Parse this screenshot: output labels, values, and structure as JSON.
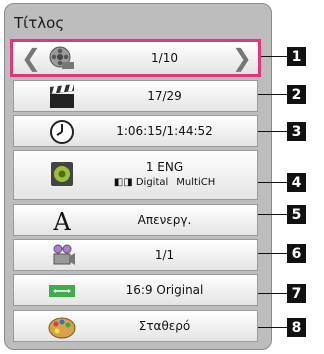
{
  "panel": {
    "title": "Τίτλος"
  },
  "rows": [
    {
      "icon": "film-reel-camera-icon",
      "value": "1/10",
      "callout": "1"
    },
    {
      "icon": "clapperboard-icon",
      "value": "17/29",
      "callout": "2"
    },
    {
      "icon": "clock-icon",
      "value": "1:06:15/1:44:52",
      "callout": "3"
    },
    {
      "icon": "speaker-icon",
      "value": "1 ENG",
      "sub_a": "Digital",
      "sub_b": "MultiCH",
      "callout": "4"
    },
    {
      "icon": "subtitle-letter-icon",
      "value": "Απενεργ.",
      "callout": "5"
    },
    {
      "icon": "camera-angle-icon",
      "value": "1/1",
      "callout": "6"
    },
    {
      "icon": "aspect-ratio-icon",
      "value": "16:9 Original",
      "callout": "7"
    },
    {
      "icon": "palette-icon",
      "value": "Σταθερό",
      "callout": "8"
    }
  ],
  "colors": {
    "highlight": "#e8347c",
    "panel": "#bdbdbd"
  }
}
